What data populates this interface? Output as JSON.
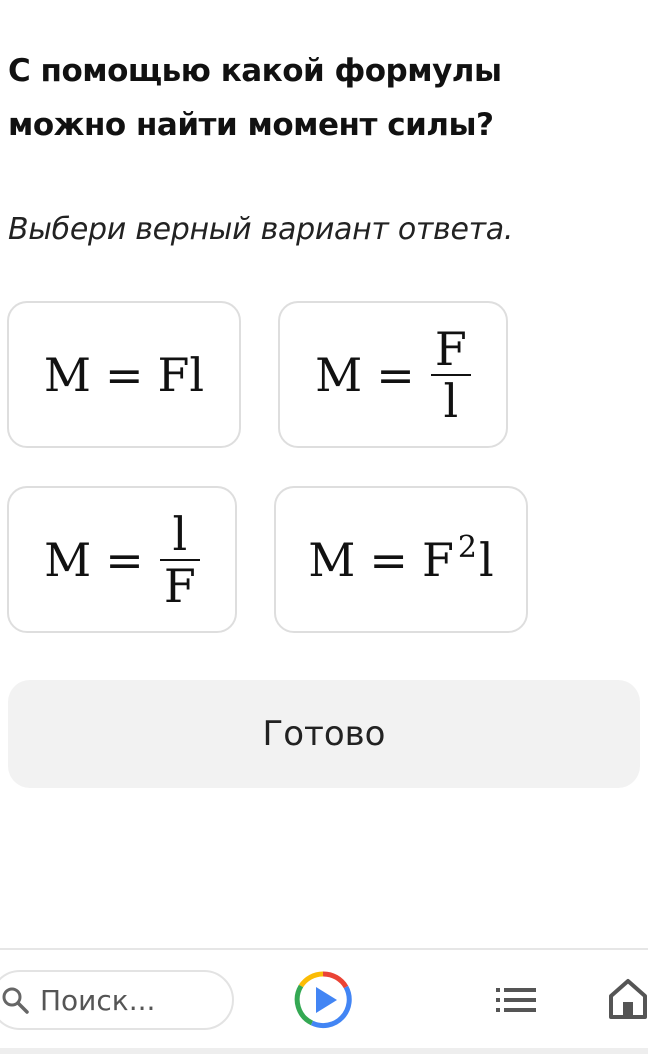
{
  "question": {
    "title": "С помощью какой формулы можно найти момент силы?",
    "instruction": "Выбери верный вариант ответа."
  },
  "options": [
    {
      "lhs": "M",
      "eq": "=",
      "rhs": "Fl"
    },
    {
      "lhs": "M",
      "eq": "=",
      "numerator": "F",
      "denominator": "l"
    },
    {
      "lhs": "M",
      "eq": "=",
      "numerator": "l",
      "denominator": "F"
    },
    {
      "lhs": "M",
      "eq": "=",
      "base": "F",
      "exponent": "2",
      "tail": "l"
    }
  ],
  "actions": {
    "done_label": "Готово"
  },
  "bottom_bar": {
    "search_placeholder": "Поиск...",
    "icons": [
      "search-icon",
      "play-icon",
      "menu-icon",
      "home-icon"
    ],
    "play_colors": [
      "#EA4335",
      "#FBBC05",
      "#34A853",
      "#4285F4"
    ]
  }
}
